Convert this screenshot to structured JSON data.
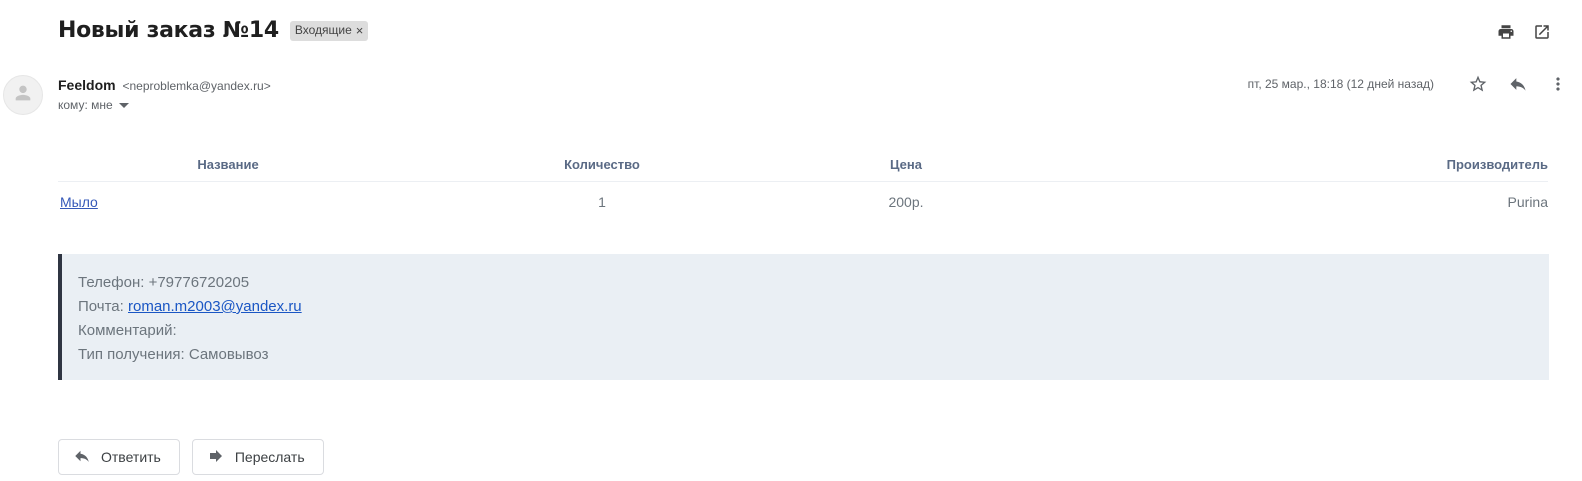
{
  "email": {
    "subject": "Новый заказ №14",
    "label": "Входящие",
    "label_remove": "×",
    "sender_name": "Feeldom",
    "sender_email": "<neproblemka@yandex.ru>",
    "recipient": "кому: мне",
    "date": "пт, 25 мар., 18:18 (12 дней назад)"
  },
  "order_table": {
    "headers": [
      "Название",
      "Количество",
      "Цена",
      "Производитель"
    ],
    "rows": [
      {
        "name": "Мыло",
        "quantity": "1",
        "price": "200р.",
        "manufacturer": "Purina"
      }
    ]
  },
  "contact": {
    "phone_label": "Телефон:",
    "phone": "+79776720205",
    "mail_label": "Почта:",
    "mail": "roman.m2003@yandex.ru",
    "comment_label": "Комментарий:",
    "comment": "",
    "delivery_label": "Тип получения:",
    "delivery": "Самовывоз"
  },
  "actions": {
    "reply": "Ответить",
    "forward": "Переслать"
  },
  "icons": [
    "print-icon",
    "open-in-new-window-icon",
    "star-icon",
    "reply-icon",
    "more-vert-icon",
    "person-icon",
    "caret-down-icon",
    "forward-icon"
  ],
  "colors": {
    "link": "#3558b8",
    "header_text": "#5a6a85",
    "info_bg": "#eaeff4",
    "info_border": "#2f3542"
  }
}
